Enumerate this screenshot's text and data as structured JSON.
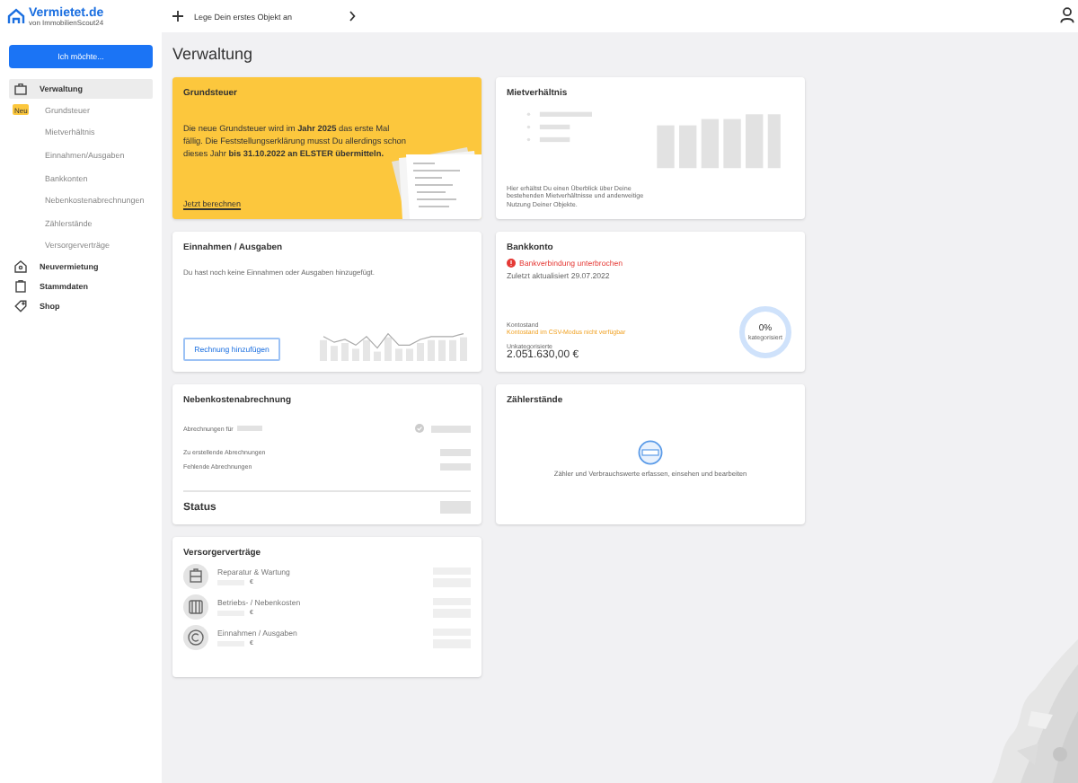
{
  "header": {
    "logo": "Vermietet.de",
    "tagline": "von ImmobilienScout24",
    "cta": "Lege Dein erstes Objekt an"
  },
  "sidebar": {
    "button": "Ich möchte...",
    "items": [
      {
        "label": "Verwaltung",
        "selected": true,
        "children": [
          {
            "label": "Grundsteuer",
            "badge": "Neu",
            "selected": false
          },
          {
            "label": "Mietverhältnis",
            "selected": false
          },
          {
            "label": "Einnahmen/Ausgaben",
            "selected": false
          },
          {
            "label": "Bankkonten",
            "selected": false
          },
          {
            "label": "Nebenkostenabrechnungen",
            "selected": false
          },
          {
            "label": "Zählerstände",
            "selected": false
          },
          {
            "label": "Versorgerverträge",
            "selected": false
          }
        ]
      },
      {
        "label": "Neuvermietung",
        "selected": false
      },
      {
        "label": "Stammdaten",
        "selected": false
      },
      {
        "label": "Shop",
        "selected": false
      }
    ]
  },
  "page_title": "Verwaltung",
  "grundsteuer": {
    "title": "Grundsteuer",
    "text": "Die neue Grundsteuer wird im **Jahr 2025** das erste Mal fällig. Die Feststellungserklärung musst Du allerdings schon dieses Jahr **bis 31.10.2022 an ELSTER übermitteln.**",
    "link": "Jetzt berechnen"
  },
  "mietverhaeltnis": {
    "title": "Mietverhältnis",
    "text": "Hier erhältst Du einen Überblick über Deine bestehenden Mietverhältnisse und anderweitige Nutzung Deiner Objekte."
  },
  "einnahmen": {
    "title": "Einnahmen / Ausgaben",
    "text": "Du hast noch keine Einnahmen oder Ausgaben hinzugefügt.",
    "button": "Rechnung hinzufügen"
  },
  "bankkonto": {
    "title": "Bankkonto",
    "alert": "Bankverbindung unterbrochen",
    "updated": "Zuletzt aktualisiert 29.07.2022",
    "balance_label": "Kontostand",
    "balance_note": "Kontostand im CSV-Modus nicht verfügbar",
    "uncategorized_label": "Unkategorisierte",
    "amount": "2.051.630,00 €",
    "donut": {
      "value": "0%",
      "label": "kategorisiert"
    }
  },
  "nebenkosten": {
    "title": "Nebenkostenabrechnung",
    "rows": [
      "Abrechnungen für",
      "Zu erstellende Abrechnungen",
      "Fehlende Abrechnungen"
    ],
    "status": "Status"
  },
  "zaehler": {
    "title": "Zählerstände",
    "text": "Zähler und Verbrauchswerte erfassen, einsehen und bearbeiten"
  },
  "versorger": {
    "title": "Versorgerverträge",
    "items": [
      {
        "name": "Reparatur & Wartung",
        "currency": "€"
      },
      {
        "name": "Betriebs- / Nebenkosten",
        "currency": "€"
      },
      {
        "name": "Einnahmen / Ausgaben",
        "currency": "€"
      }
    ]
  }
}
